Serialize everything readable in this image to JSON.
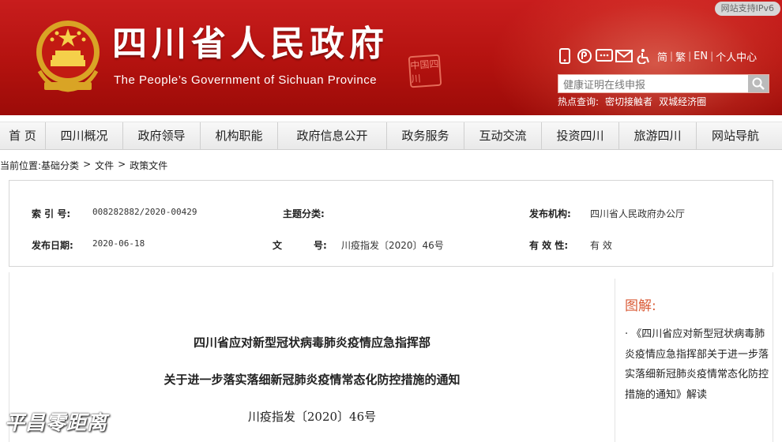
{
  "header": {
    "title": "四川省人民政府",
    "subtitle": "The People’s Government of Sichuan Province",
    "seal_text": "中国四川",
    "ipv6_badge": "网站支持IPv6",
    "tools": {
      "icons": [
        "mobile-icon",
        "weibo-icon",
        "wechat-icon",
        "mail-icon",
        "accessibility-icon"
      ],
      "links": [
        "简",
        "繁",
        "EN",
        "个人中心"
      ]
    },
    "search": {
      "value": "健康证明在线申报"
    },
    "hot": {
      "label": "热点查询:",
      "items": [
        "密切接触者",
        "双城经济圈"
      ]
    }
  },
  "nav": {
    "items": [
      "首 页",
      "四川概况",
      "政府领导",
      "机构职能",
      "政府信息公开",
      "政务服务",
      "互动交流",
      "投资四川",
      "旅游四川",
      "网站导航"
    ]
  },
  "breadcrumb": {
    "label": "当前位置:",
    "items": [
      "基础分类",
      "文件",
      "政策文件"
    ],
    "separator": ">"
  },
  "meta": {
    "index_label": "索 引 号:",
    "index_value": "008282882/2020-00429",
    "category_label": "主题分类:",
    "category_value": "",
    "issuer_label": "发布机构:",
    "issuer_value": "四川省人民政府办公厅",
    "date_label": "发布日期:",
    "date_value": "2020-06-18",
    "doc_label_a": "文",
    "doc_label_b": "号:",
    "doc_value": "川疫指发〔2020〕46号",
    "validity_label": "有 效 性:",
    "validity_value": "有 效"
  },
  "document": {
    "title_line1": "四川省应对新型冠状病毒肺炎疫情应急指挥部",
    "title_line2": "关于进一步落实落细新冠肺炎疫情常态化防控措施的通知",
    "doc_number": "川疫指发〔2020〕46号"
  },
  "aside": {
    "title": "图解:",
    "text": "· 《四川省应对新型冠状病毒肺炎疫情应急指挥部关于进一步落实落细新冠肺炎疫情常态化防控措施的通知》解读"
  },
  "watermark": "平昌零距离",
  "colors": {
    "header_red": "#b3120f",
    "accent_orange": "#d95b37"
  }
}
